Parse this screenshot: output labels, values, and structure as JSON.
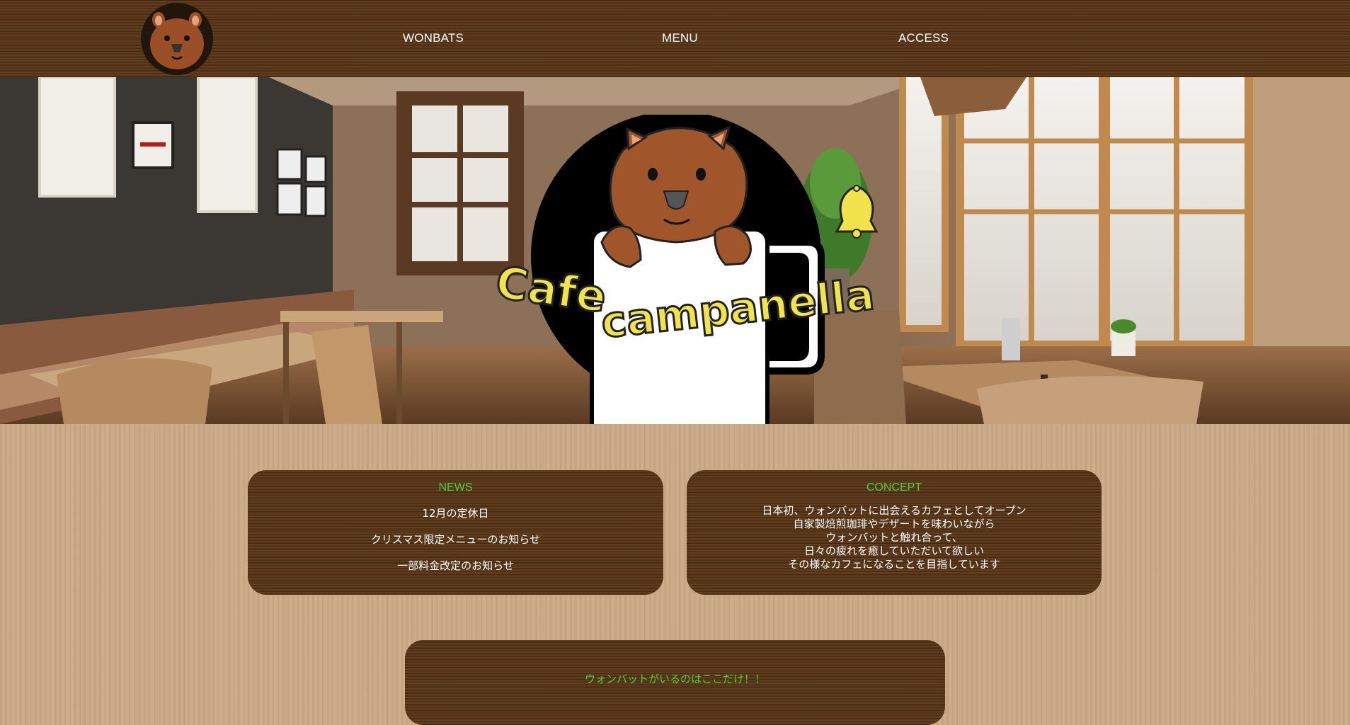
{
  "header": {
    "nav": [
      {
        "label": "WONBATS"
      },
      {
        "label": "MENU"
      },
      {
        "label": "ACCESS"
      }
    ]
  },
  "hero": {
    "logo_text": "Cafe campanella"
  },
  "news": {
    "title": "NEWS",
    "items": [
      "12月の定休日",
      "クリスマス限定メニューのお知らせ",
      "一部料金改定のお知らせ"
    ]
  },
  "concept": {
    "title": "CONCEPT",
    "lines": [
      "日本初、ウォンバットに出会えるカフェとしてオープン",
      "自家製焙煎珈琲やデザートを味わいながら",
      "ウォンバットと触れ合って、",
      "日々の疲れを癒していただいて欲しい",
      "その様なカフェになることを目指しています"
    ]
  },
  "promo": {
    "text": "ウォンバットがいるのはここだけ！！"
  },
  "colors": {
    "accent_green": "#4cd13a",
    "wood_dark": "#5a3716",
    "wood_light": "#c9a986",
    "logo_yellow": "#f2e34c"
  }
}
